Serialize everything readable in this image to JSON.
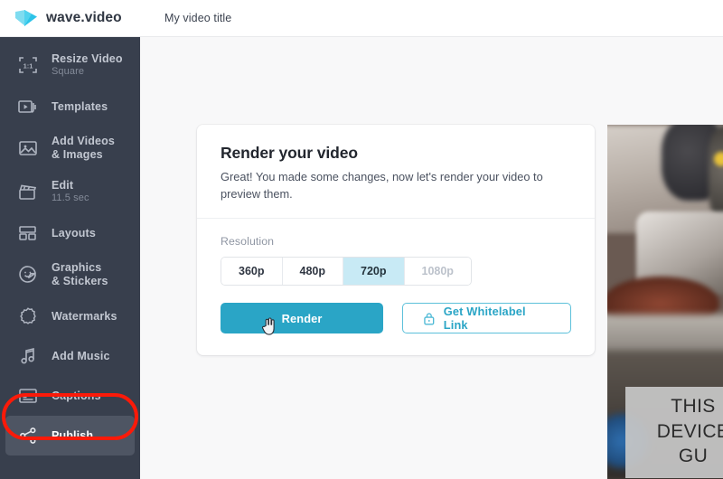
{
  "header": {
    "logo_icon": "wave-play-logo",
    "brand": "wave.video",
    "document_title": "My video title"
  },
  "sidebar": {
    "items": [
      {
        "icon": "resize-frame-icon",
        "label": "Resize Video",
        "sub": "Square",
        "active": false
      },
      {
        "icon": "templates-icon",
        "label": "Templates",
        "sub": "",
        "active": false
      },
      {
        "icon": "image-icon",
        "label": "Add Videos\n& Images",
        "sub": "",
        "active": false
      },
      {
        "icon": "clapperboard-icon",
        "label": "Edit",
        "sub": "11.5 sec",
        "active": false
      },
      {
        "icon": "layouts-icon",
        "label": "Layouts",
        "sub": "",
        "active": false
      },
      {
        "icon": "smiley-sticker-icon",
        "label": "Graphics\n& Stickers",
        "sub": "",
        "active": false
      },
      {
        "icon": "watermark-badge-icon",
        "label": "Watermarks",
        "sub": "",
        "active": false
      },
      {
        "icon": "music-note-icon",
        "label": "Add Music",
        "sub": "",
        "active": false
      },
      {
        "icon": "captions-icon",
        "label": "Captions",
        "sub": "",
        "active": false
      },
      {
        "icon": "share-icon",
        "label": "Publish",
        "sub": "",
        "active": true
      }
    ],
    "highlight_color": "#fb1a09",
    "background_color": "#383f4d",
    "active_background_color": "#4e5563"
  },
  "card": {
    "title": "Render your video",
    "description": "Great! You made some changes, now let's render your video to preview them.",
    "resolution_label": "Resolution",
    "resolutions": [
      {
        "label": "360p",
        "state": "enabled"
      },
      {
        "label": "480p",
        "state": "enabled"
      },
      {
        "label": "720p",
        "state": "selected"
      },
      {
        "label": "1080p",
        "state": "disabled"
      }
    ],
    "selected_resolution": "720p",
    "render_button": "Render",
    "whitelabel_button": "Get Whitelabel Link",
    "whitelabel_icon": "lock-icon",
    "accent_color": "#2aa5c6",
    "selected_chip_color": "#c8eaf5"
  },
  "preview": {
    "caption_text": "THIS\nDEVICE\nGU"
  },
  "cursor": {
    "icon": "pointing-hand-cursor"
  }
}
